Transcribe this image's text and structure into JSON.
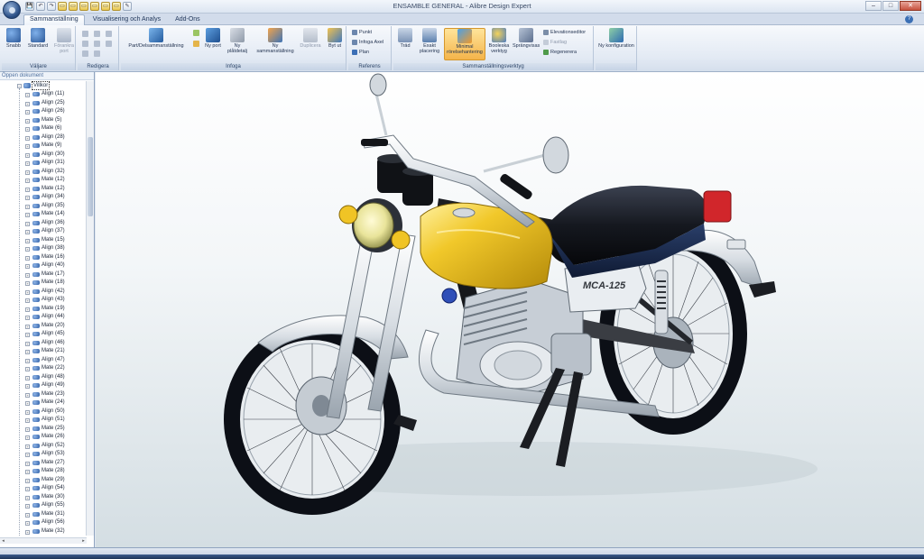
{
  "window": {
    "title": "ENSAMBLE GENERAL - Alibre Design Expert",
    "controls": [
      "–",
      "□",
      "✕"
    ]
  },
  "qat": [
    "💾",
    "↶",
    "↷",
    "▭",
    "▭",
    "▭",
    "▭",
    "▭",
    "▭",
    "✎"
  ],
  "tabs": [
    "Sammanställning",
    "Visualisering och Analys",
    "Add-Ons"
  ],
  "help": "?",
  "ribbon": {
    "groups": {
      "vallare": "Väljare",
      "redigera": "Redigera",
      "infoga": "Infoga",
      "referens": "Referens",
      "verktyg": "Sammanställningsverktyg"
    },
    "buttons": {
      "snabb": "Snabb",
      "standard": "Standard",
      "foranlinie": "Förankra port",
      "port_del": "Part/Delsammanställning",
      "ny_port": "Ny port",
      "ny_platdetalj": "Ny plåtdetalj",
      "ny_sammanstallning": "Ny sammanställning",
      "duplicera": "Duplicera",
      "byt_ut": "Byt ut",
      "punkt": "Punkt",
      "infoga_axel": "Infoga Axel",
      "plan": "Plan",
      "trad": "Träd",
      "exakt_placering": "Exakt placering",
      "minimal_rorelse": "Minimal rörelsehantering",
      "booleska": "Booleska verktyg",
      "sprangvy": "Sprängvisas",
      "ny_konfiguration": "Ny konfiguration",
      "elevationseditor": "Elevationseditor",
      "fastlag": "Fastlag",
      "regenerera": "Regenerera"
    }
  },
  "tree": {
    "header": "Öppen dokument",
    "root": "Villkor",
    "items": [
      {
        "label": "Align (11)"
      },
      {
        "label": "Align (25)"
      },
      {
        "label": "Align (26)"
      },
      {
        "label": "Mate (5)"
      },
      {
        "label": "Mate (6)"
      },
      {
        "label": "Align (28)"
      },
      {
        "label": "Mate (9)"
      },
      {
        "label": "Align (30)"
      },
      {
        "label": "Align (31)"
      },
      {
        "label": "Align (32)"
      },
      {
        "label": "Mate (12)"
      },
      {
        "label": "Mate (12)"
      },
      {
        "label": "Align (34)"
      },
      {
        "label": "Align (35)"
      },
      {
        "label": "Mate (14)"
      },
      {
        "label": "Align (36)"
      },
      {
        "label": "Align (37)"
      },
      {
        "label": "Mate (15)"
      },
      {
        "label": "Align (38)"
      },
      {
        "label": "Mate (16)"
      },
      {
        "label": "Align (40)"
      },
      {
        "label": "Mate (17)"
      },
      {
        "label": "Mate (18)"
      },
      {
        "label": "Align (42)"
      },
      {
        "label": "Align (43)"
      },
      {
        "label": "Mate (19)"
      },
      {
        "label": "Align (44)"
      },
      {
        "label": "Mate (20)"
      },
      {
        "label": "Align (45)"
      },
      {
        "label": "Align (46)"
      },
      {
        "label": "Mate (21)"
      },
      {
        "label": "Align (47)"
      },
      {
        "label": "Mate (22)"
      },
      {
        "label": "Align (48)"
      },
      {
        "label": "Align (49)"
      },
      {
        "label": "Mate (23)"
      },
      {
        "label": "Mate (24)"
      },
      {
        "label": "Align (50)"
      },
      {
        "label": "Align (51)"
      },
      {
        "label": "Mate (25)"
      },
      {
        "label": "Mate (26)"
      },
      {
        "label": "Align (52)"
      },
      {
        "label": "Align (53)"
      },
      {
        "label": "Mate (27)"
      },
      {
        "label": "Mate (28)"
      },
      {
        "label": "Mate (29)"
      },
      {
        "label": "Align (54)"
      },
      {
        "label": "Mate (30)"
      },
      {
        "label": "Align (55)"
      },
      {
        "label": "Mate (31)"
      },
      {
        "label": "Align (56)"
      },
      {
        "label": "Mate (32)"
      }
    ]
  },
  "viewport": {
    "tank_badge": "MCA-125"
  },
  "colors": {
    "accent": "#2b5797",
    "tank": "#f1c82a",
    "seat": "#1c1f26",
    "chrome": "#e8ecef"
  }
}
